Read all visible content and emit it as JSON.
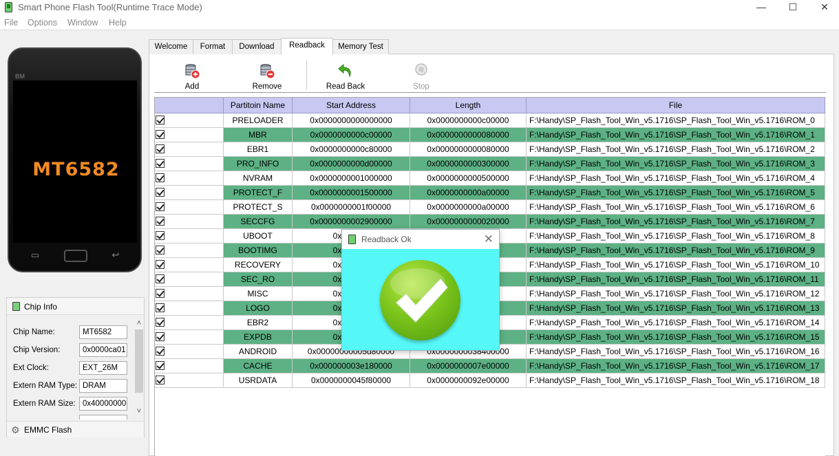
{
  "window": {
    "title": "Smart Phone Flash Tool(Runtime Trace Mode)",
    "minimize": "—",
    "maximize": "☐",
    "close": "✕"
  },
  "menu": [
    "File",
    "Options",
    "Window",
    "Help"
  ],
  "phone": {
    "brand": "BM",
    "chip": "MT6582"
  },
  "chip_info": {
    "title": "Chip Info",
    "rows": [
      {
        "label": "Chip Name:",
        "value": "MT6582"
      },
      {
        "label": "Chip Version:",
        "value": "0x0000ca01"
      },
      {
        "label": "Ext Clock:",
        "value": "EXT_26M"
      },
      {
        "label": "Extern RAM Type:",
        "value": "DRAM"
      },
      {
        "label": "Extern RAM Size:",
        "value": "0x40000000"
      }
    ],
    "emmc_title": "EMMC Flash"
  },
  "tabs": [
    "Welcome",
    "Format",
    "Download",
    "Readback",
    "Memory Test"
  ],
  "active_tab": "Readback",
  "toolbar": {
    "add": "Add",
    "remove": "Remove",
    "read_back": "Read Back",
    "stop": "Stop"
  },
  "columns": [
    "",
    "Partitoin Name",
    "Start Address",
    "Length",
    "File"
  ],
  "rows": [
    {
      "name": "PRELOADER",
      "start": "0x0000000000000000",
      "length": "0x0000000000c00000",
      "file": "F:\\Handy\\SP_Flash_Tool_Win_v5.1716\\SP_Flash_Tool_Win_v5.1716\\ROM_0"
    },
    {
      "name": "MBR",
      "start": "0x0000000000c00000",
      "length": "0x0000000000080000",
      "file": "F:\\Handy\\SP_Flash_Tool_Win_v5.1716\\SP_Flash_Tool_Win_v5.1716\\ROM_1"
    },
    {
      "name": "EBR1",
      "start": "0x0000000000c80000",
      "length": "0x0000000000080000",
      "file": "F:\\Handy\\SP_Flash_Tool_Win_v5.1716\\SP_Flash_Tool_Win_v5.1716\\ROM_2"
    },
    {
      "name": "PRO_INFO",
      "start": "0x0000000000d00000",
      "length": "0x0000000000300000",
      "file": "F:\\Handy\\SP_Flash_Tool_Win_v5.1716\\SP_Flash_Tool_Win_v5.1716\\ROM_3"
    },
    {
      "name": "NVRAM",
      "start": "0x0000000001000000",
      "length": "0x0000000000500000",
      "file": "F:\\Handy\\SP_Flash_Tool_Win_v5.1716\\SP_Flash_Tool_Win_v5.1716\\ROM_4"
    },
    {
      "name": "PROTECT_F",
      "start": "0x0000000001500000",
      "length": "0x0000000000a00000",
      "file": "F:\\Handy\\SP_Flash_Tool_Win_v5.1716\\SP_Flash_Tool_Win_v5.1716\\ROM_5"
    },
    {
      "name": "PROTECT_S",
      "start": "0x0000000001f00000",
      "length": "0x0000000000a00000",
      "file": "F:\\Handy\\SP_Flash_Tool_Win_v5.1716\\SP_Flash_Tool_Win_v5.1716\\ROM_6"
    },
    {
      "name": "SECCFG",
      "start": "0x0000000002900000",
      "length": "0x0000000000020000",
      "file": "F:\\Handy\\SP_Flash_Tool_Win_v5.1716\\SP_Flash_Tool_Win_v5.1716\\ROM_7"
    },
    {
      "name": "UBOOT",
      "start": "0x000000",
      "length": "00",
      "file": "F:\\Handy\\SP_Flash_Tool_Win_v5.1716\\SP_Flash_Tool_Win_v5.1716\\ROM_8"
    },
    {
      "name": "BOOTIMG",
      "start": "0x000000",
      "length": "00",
      "file": "F:\\Handy\\SP_Flash_Tool_Win_v5.1716\\SP_Flash_Tool_Win_v5.1716\\ROM_9"
    },
    {
      "name": "RECOVERY",
      "start": "0x000000",
      "length": "00",
      "file": "F:\\Handy\\SP_Flash_Tool_Win_v5.1716\\SP_Flash_Tool_Win_v5.1716\\ROM_10"
    },
    {
      "name": "SEC_RO",
      "start": "0x000000",
      "length": "00",
      "file": "F:\\Handy\\SP_Flash_Tool_Win_v5.1716\\SP_Flash_Tool_Win_v5.1716\\ROM_11"
    },
    {
      "name": "MISC",
      "start": "0x000000",
      "length": "00",
      "file": "F:\\Handy\\SP_Flash_Tool_Win_v5.1716\\SP_Flash_Tool_Win_v5.1716\\ROM_12"
    },
    {
      "name": "LOGO",
      "start": "0x000000",
      "length": "00",
      "file": "F:\\Handy\\SP_Flash_Tool_Win_v5.1716\\SP_Flash_Tool_Win_v5.1716\\ROM_13"
    },
    {
      "name": "EBR2",
      "start": "0x000000",
      "length": "00",
      "file": "F:\\Handy\\SP_Flash_Tool_Win_v5.1716\\SP_Flash_Tool_Win_v5.1716\\ROM_14"
    },
    {
      "name": "EXPDB",
      "start": "0x000000",
      "length": "00",
      "file": "F:\\Handy\\SP_Flash_Tool_Win_v5.1716\\SP_Flash_Tool_Win_v5.1716\\ROM_15"
    },
    {
      "name": "ANDROID",
      "start": "0x00000000005d80000",
      "length": "0x0000000038400000",
      "file": "F:\\Handy\\SP_Flash_Tool_Win_v5.1716\\SP_Flash_Tool_Win_v5.1716\\ROM_16"
    },
    {
      "name": "CACHE",
      "start": "0x000000003e180000",
      "length": "0x0000000007e00000",
      "file": "F:\\Handy\\SP_Flash_Tool_Win_v5.1716\\SP_Flash_Tool_Win_v5.1716\\ROM_17"
    },
    {
      "name": "USRDATA",
      "start": "0x0000000045f80000",
      "length": "0x0000000092e00000",
      "file": "F:\\Handy\\SP_Flash_Tool_Win_v5.1716\\SP_Flash_Tool_Win_v5.1716\\ROM_18"
    }
  ],
  "dialog": {
    "title": "Readback Ok",
    "close": "✕"
  },
  "colors": {
    "row_green": "#5db184",
    "header_lavender": "#c8c8f2",
    "dialog_cyan": "#56f7f7",
    "check_green": "#7cc51c",
    "chip_orange": "#f08a24"
  }
}
